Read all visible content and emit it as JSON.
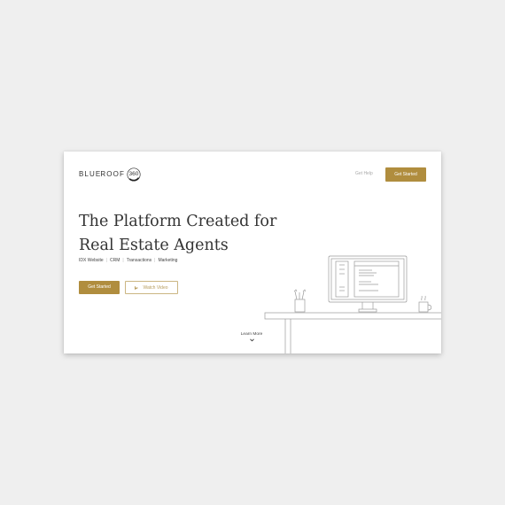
{
  "brand": {
    "name_part1": "BLU",
    "name_mark": "E",
    "name_part2": "ROOF",
    "badge": "360"
  },
  "nav": {
    "help_label": "Get Help",
    "cta_label": "Get Started"
  },
  "hero": {
    "headline_line1": "The Platform Created for",
    "headline_line2": "Real Estate Agents",
    "features": [
      "IDX Website",
      "CRM",
      "Transactions",
      "Marketing"
    ],
    "primary_cta": "Get Started",
    "secondary_cta": "Watch Video",
    "learn_more": "Learn More"
  },
  "colors": {
    "accent": "#b08d3e",
    "page_bg": "#efefef",
    "card_bg": "#ffffff",
    "text": "#333333"
  },
  "icons": {
    "play": "play-icon",
    "chevron": "chevron-down-icon"
  }
}
